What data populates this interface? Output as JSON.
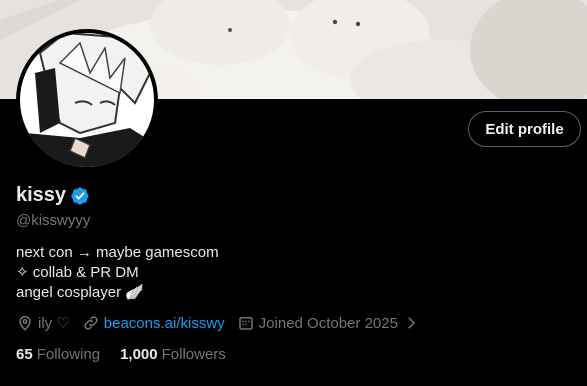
{
  "profile": {
    "name": "kissy",
    "handle": "@kisswyyy",
    "bio_lines": [
      "next con → maybe gamescom",
      "✧ collab & PR DM",
      "angel cosplayer 🪽"
    ],
    "edit_label": "Edit profile",
    "location": "ily ♡",
    "website": "beacons.ai/kisswy",
    "joined": "Joined October 2025"
  },
  "stats": {
    "following_count": "65",
    "following_label": "Following",
    "followers_count": "1,000",
    "followers_label": "Followers"
  },
  "icons": {
    "verified": "verified-badge-icon",
    "location": "location-pin-icon",
    "link": "link-icon",
    "calendar": "calendar-icon",
    "chevron": "chevron-right-icon"
  },
  "colors": {
    "background": "#000000",
    "text_primary": "#e7e9ea",
    "text_secondary": "#71767b",
    "accent": "#1d9bf0"
  }
}
